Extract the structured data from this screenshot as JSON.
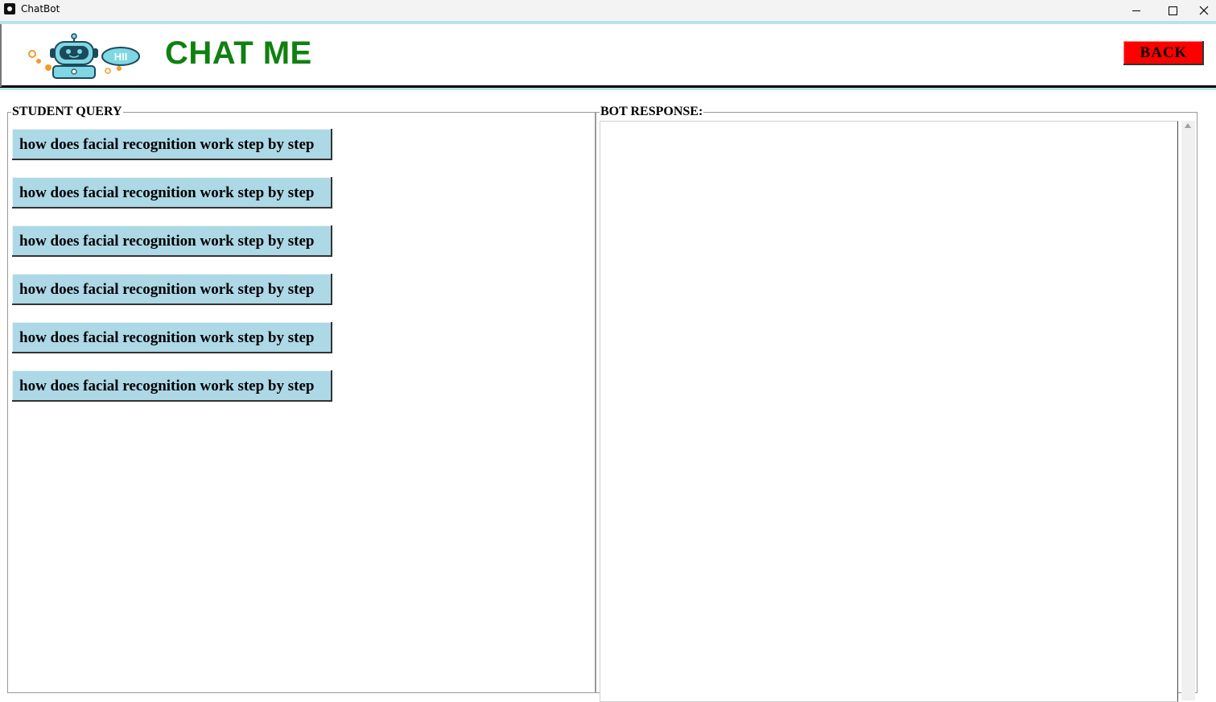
{
  "window": {
    "title": "ChatBot"
  },
  "header": {
    "title": "CHAT ME",
    "logo_text": "HII",
    "back_label": "BACK"
  },
  "student_query": {
    "label": "STUDENT QUERY",
    "queries": [
      "how does facial recognition work step by step",
      "how does facial recognition work step by step",
      "how does facial recognition work step by step",
      "how does facial recognition work step by step",
      "how does facial recognition work step by step",
      "how does facial recognition work step by step"
    ]
  },
  "bot_response": {
    "label": "BOT RESPONSE:",
    "text": ""
  },
  "colors": {
    "title_green": "#108010",
    "back_red": "#ff0000",
    "query_button": "#add8e6",
    "accent_cyan": "#b9e3e8"
  },
  "icons": {
    "app": "panda-icon",
    "minimize": "minimize-icon",
    "maximize": "maximize-icon",
    "close": "close-icon",
    "logo": "robot-logo-icon",
    "scroll_up": "scroll-up-arrow-icon"
  }
}
